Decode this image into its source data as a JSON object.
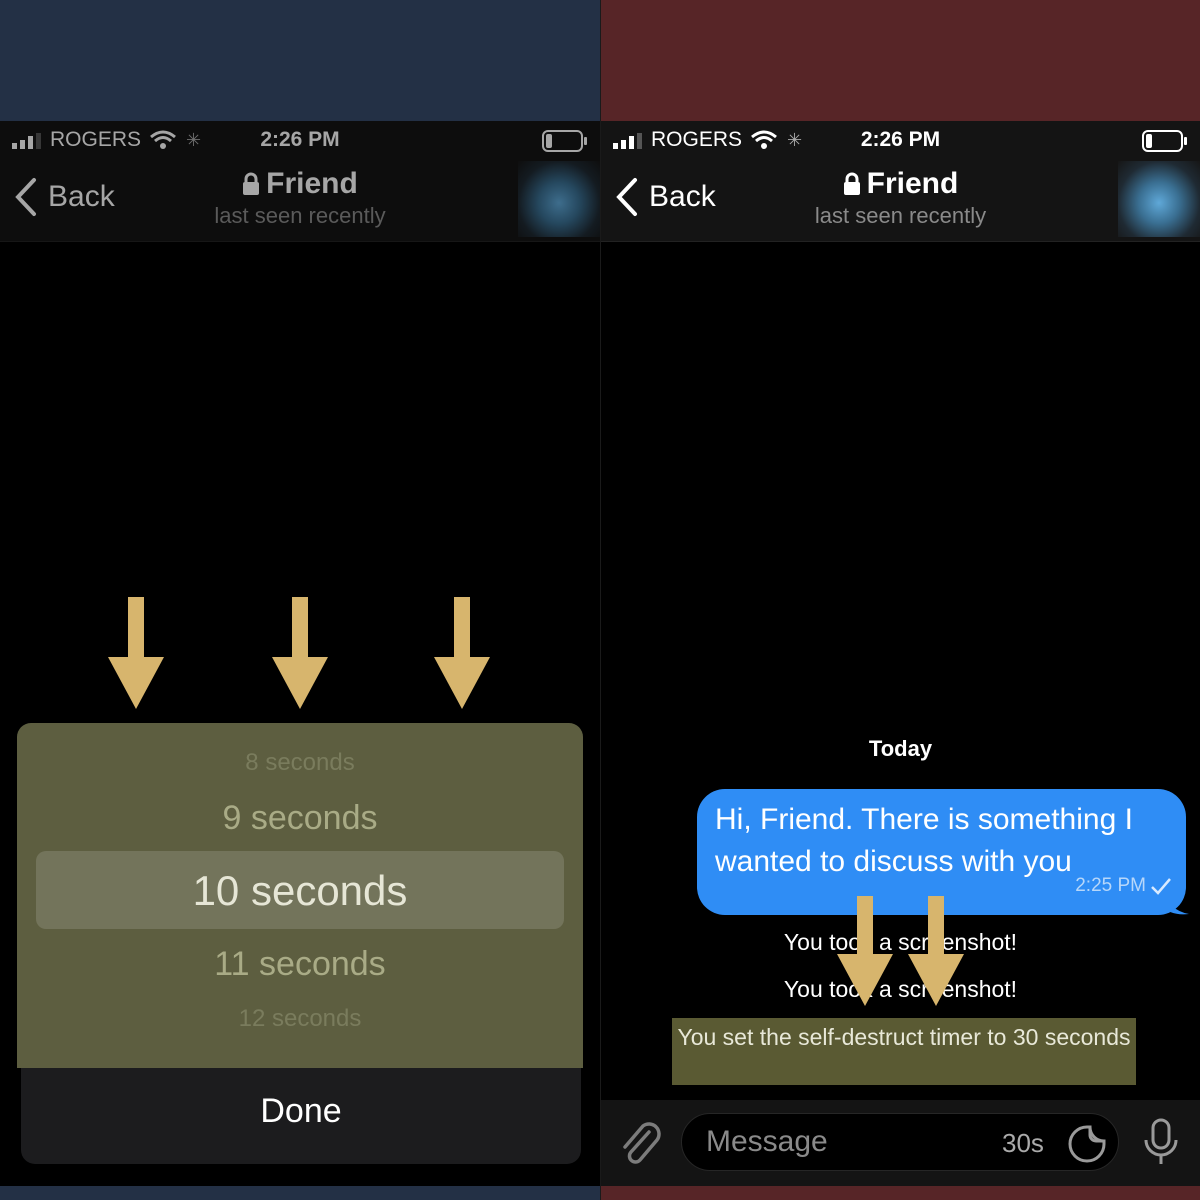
{
  "colors": {
    "left_band": "#233045",
    "right_band": "#572527",
    "arrow": "#d7b56d",
    "bubble": "#2f8df5",
    "picker_overlay": "#5d5e40",
    "highlight": "#5a5a33"
  },
  "status_bar": {
    "carrier": "ROGERS",
    "time": "2:26 PM"
  },
  "nav": {
    "back_label": "Back",
    "title": "Friend",
    "subtitle": "last seen recently",
    "icons": [
      "chevron-left-icon",
      "lock-icon",
      "avatar"
    ]
  },
  "picker": {
    "items": [
      "8 seconds",
      "9 seconds",
      "10 seconds",
      "11 seconds",
      "12 seconds"
    ],
    "selected": "10 seconds",
    "done_label": "Done"
  },
  "chat": {
    "date_label": "Today",
    "message": {
      "text": "Hi, Friend. There is something I wanted to discuss with you",
      "time": "2:25 PM"
    },
    "service_messages": [
      "You took a screenshot!",
      "You took a screenshot!"
    ],
    "timer_message": "You set the self-destruct timer to 30 seconds"
  },
  "input": {
    "placeholder": "Message",
    "timer": "30s",
    "icons": [
      "paperclip-icon",
      "sticker-icon",
      "microphone-icon"
    ]
  }
}
